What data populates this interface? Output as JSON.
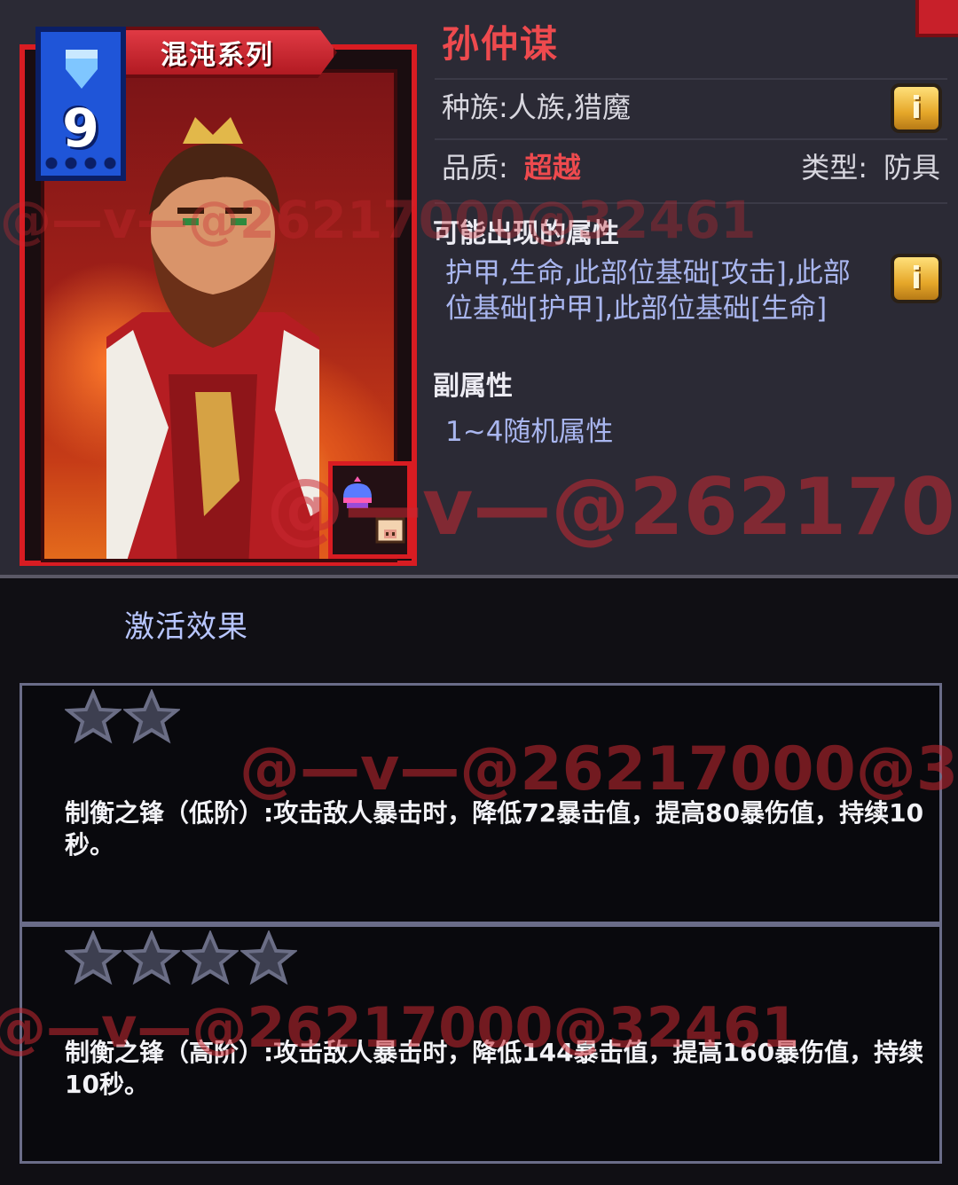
{
  "card": {
    "series_label": "混沌系列",
    "cost": "9"
  },
  "item": {
    "name": "孙仲谋",
    "race_label": "种族:",
    "race_value": "人族,猎魔",
    "quality_label": "品质:",
    "quality_value": "超越",
    "type_label": "类型:",
    "type_value": "防具",
    "possible_attrs_heading": "可能出现的属性",
    "possible_attrs_text": "护甲,生命,此部位基础[攻击],此部位基础[护甲],此部位基础[生命]",
    "sub_attrs_heading": "副属性",
    "sub_attrs_text": "1~4随机属性",
    "info_button_glyph": "i"
  },
  "activation": {
    "title": "激活效果",
    "effects": [
      {
        "stars": 2,
        "text": "制衡之锋（低阶）:攻击敌人暴击时，降低72暴击值，提高80暴伤值，持续10秒。"
      },
      {
        "stars": 4,
        "text": "制衡之锋（高阶）:攻击敌人暴击时，降低144暴击值，提高160暴伤值，持续10秒。"
      }
    ]
  },
  "watermarks": {
    "main": "@—v—@26217000@32461"
  },
  "colors": {
    "name_red": "#ee4a4e",
    "attr_blue": "#a9b6ef",
    "card_frame_red": "#d81c22",
    "cost_blue": "#1f55d8",
    "info_gold": "#e6a82a"
  },
  "icons": {
    "cost": "diamond-icon",
    "info": "info-icon",
    "slot": "helmet-icon",
    "pet": "pig-icon",
    "star": "star-icon",
    "close": "close-corner"
  }
}
